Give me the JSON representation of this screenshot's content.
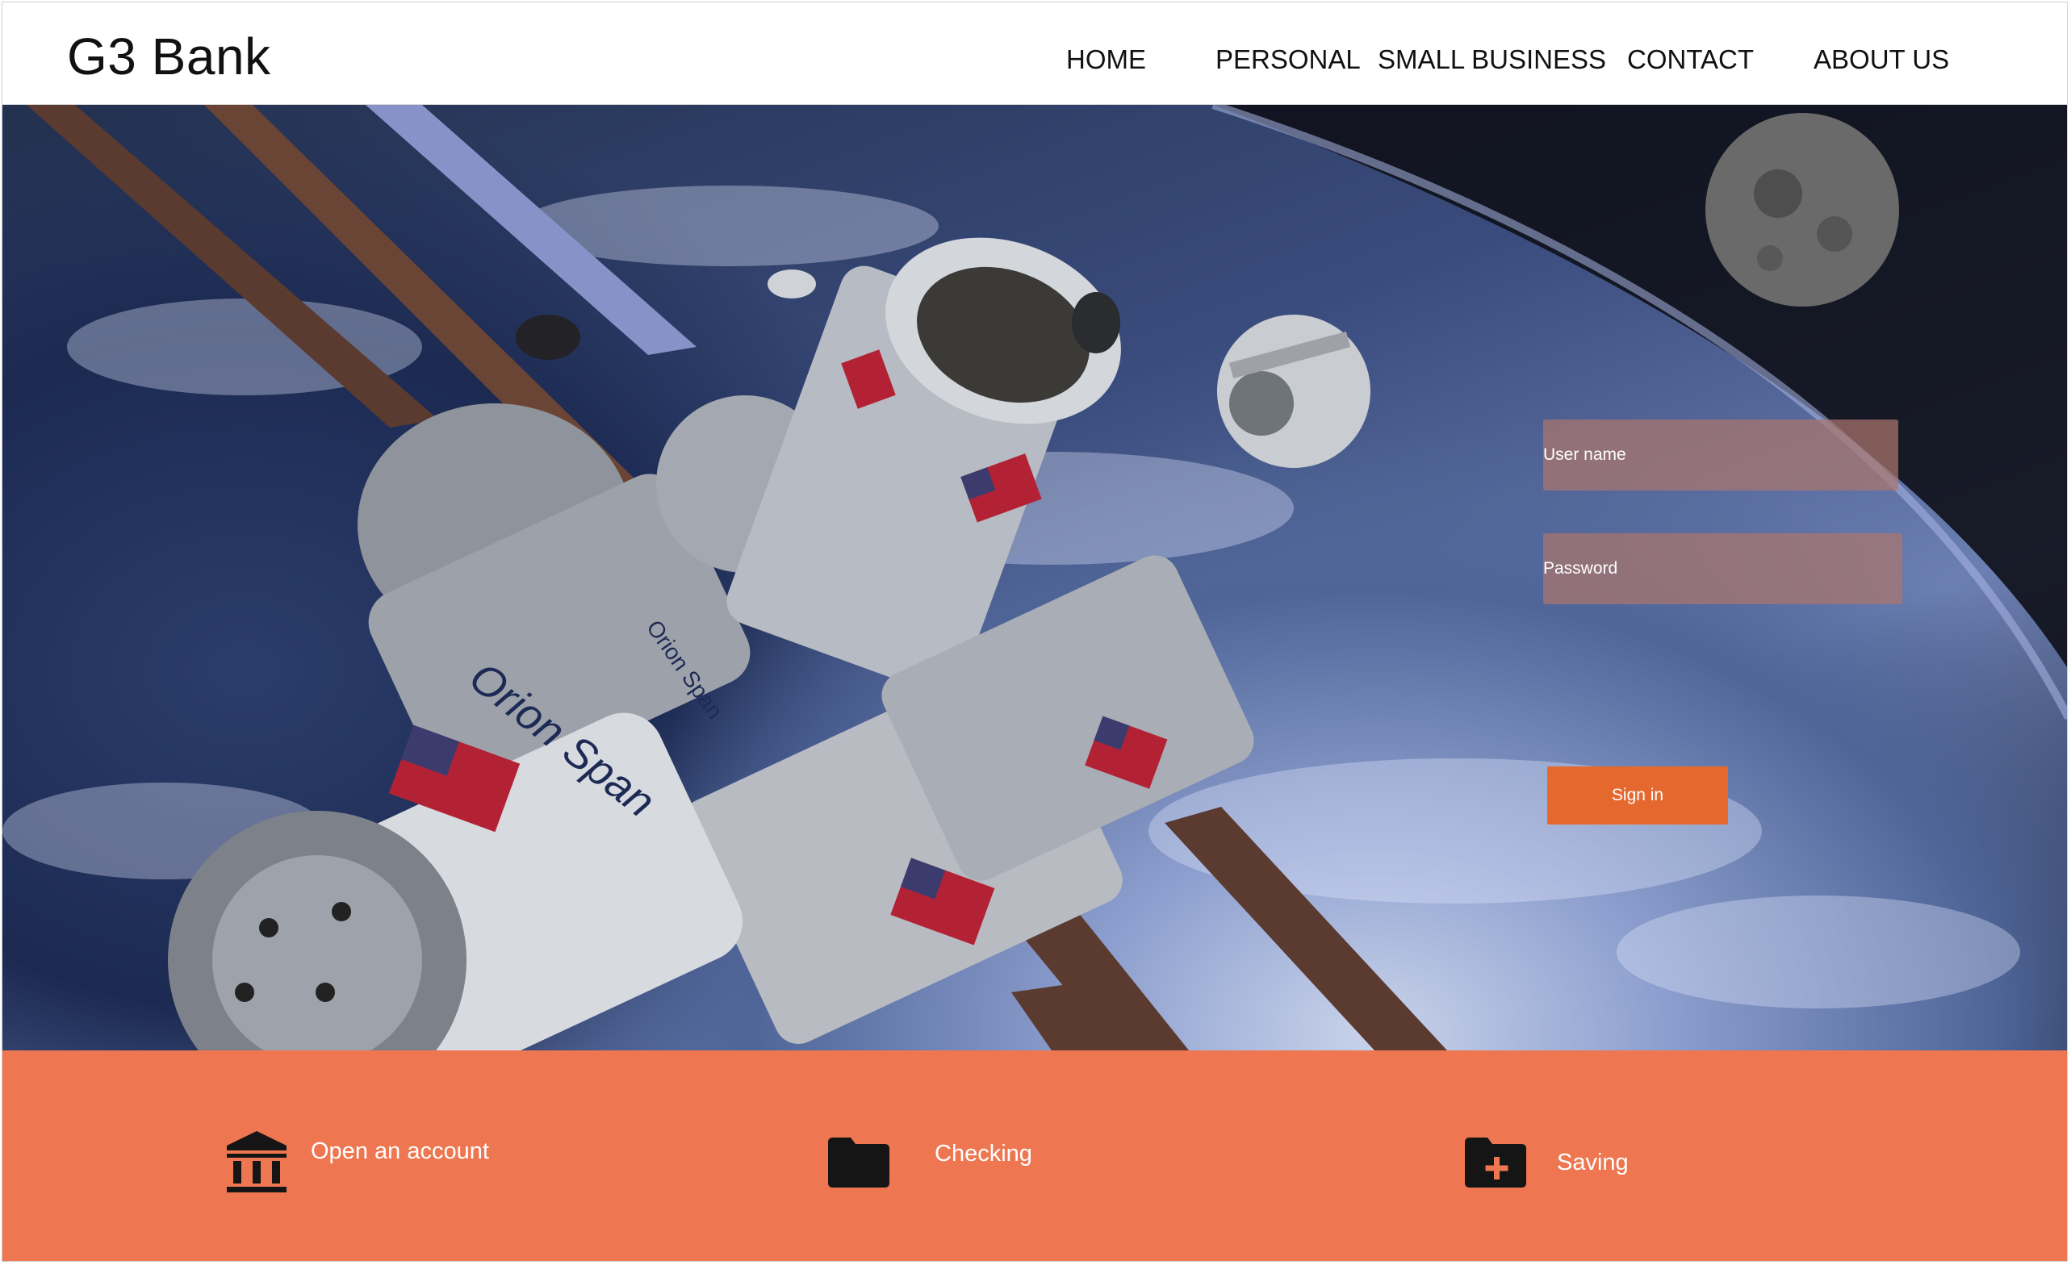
{
  "brand": {
    "name": "G3 Bank"
  },
  "nav": {
    "items": [
      {
        "label": "HOME"
      },
      {
        "label": "PERSONAL"
      },
      {
        "label": "SMALL BUSINESS"
      },
      {
        "label": "CONTACT"
      },
      {
        "label": "ABOUT US"
      }
    ]
  },
  "hero": {
    "image": "space-station-over-earth",
    "decal_text": [
      "Orion Span",
      "Orion Span"
    ]
  },
  "login": {
    "username_placeholder": "User name",
    "password_placeholder": "Password",
    "signin_label": "Sign in"
  },
  "quick_links": [
    {
      "label": "Open an account",
      "icon": "bank-icon"
    },
    {
      "label": "Checking",
      "icon": "folder-icon"
    },
    {
      "label": "Saving",
      "icon": "folder-plus-icon"
    }
  ],
  "colors": {
    "accent": "#ee7751",
    "button": "#e5692f",
    "field": "#aa766e"
  }
}
